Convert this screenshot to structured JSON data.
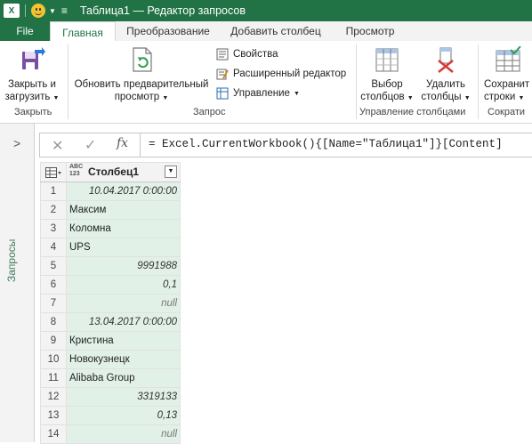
{
  "titlebar": {
    "app_icon": "excel-icon",
    "title": "Таблица1 — Редактор запросов"
  },
  "tabs": {
    "file": "File",
    "home": "Главная",
    "transform": "Преобразование",
    "add_column": "Добавить столбец",
    "view": "Просмотр"
  },
  "ribbon": {
    "close_group": {
      "label": "Закрыть",
      "close_load_line1": "Закрыть и",
      "close_load_line2": "загрузить"
    },
    "query_group": {
      "label": "Запрос",
      "refresh_line1": "Обновить предварительный",
      "refresh_line2": "просмотр",
      "properties": "Свойства",
      "advanced_editor": "Расширенный редактор",
      "manage": "Управление"
    },
    "manage_columns_group": {
      "label": "Управление столбцами",
      "choose_line1": "Выбор",
      "choose_line2": "столбцов",
      "remove_line1": "Удалить",
      "remove_line2": "столбцы"
    },
    "reduce_group": {
      "label": "Сократи",
      "keep_line1": "Сохранит",
      "keep_line2": "строки"
    }
  },
  "formula_bar": {
    "fx": "fx",
    "formula": "= Excel.CurrentWorkbook(){[Name=\"Таблица1\"]}[Content]"
  },
  "side_panel": {
    "label": "Запросы"
  },
  "grid": {
    "column_type": "ABC\n123",
    "column_name": "Столбец1",
    "rows": [
      {
        "n": "1",
        "value": "10.04.2017 0:00:00",
        "align": "right"
      },
      {
        "n": "2",
        "value": "Максим",
        "align": "left"
      },
      {
        "n": "3",
        "value": "Коломна",
        "align": "left"
      },
      {
        "n": "4",
        "value": "UPS",
        "align": "left"
      },
      {
        "n": "5",
        "value": "9991988",
        "align": "right"
      },
      {
        "n": "6",
        "value": "0,1",
        "align": "right"
      },
      {
        "n": "7",
        "value": "null",
        "align": "right"
      },
      {
        "n": "8",
        "value": "13.04.2017 0:00:00",
        "align": "right"
      },
      {
        "n": "9",
        "value": "Кристина",
        "align": "left"
      },
      {
        "n": "10",
        "value": "Новокузнецк",
        "align": "left"
      },
      {
        "n": "11",
        "value": "Alibaba Group",
        "align": "left"
      },
      {
        "n": "12",
        "value": "3319133",
        "align": "right"
      },
      {
        "n": "13",
        "value": "0,13",
        "align": "right"
      },
      {
        "n": "14",
        "value": "null",
        "align": "right"
      }
    ]
  },
  "colors": {
    "accent": "#217346",
    "cell_bg": "#e2f1e7"
  }
}
